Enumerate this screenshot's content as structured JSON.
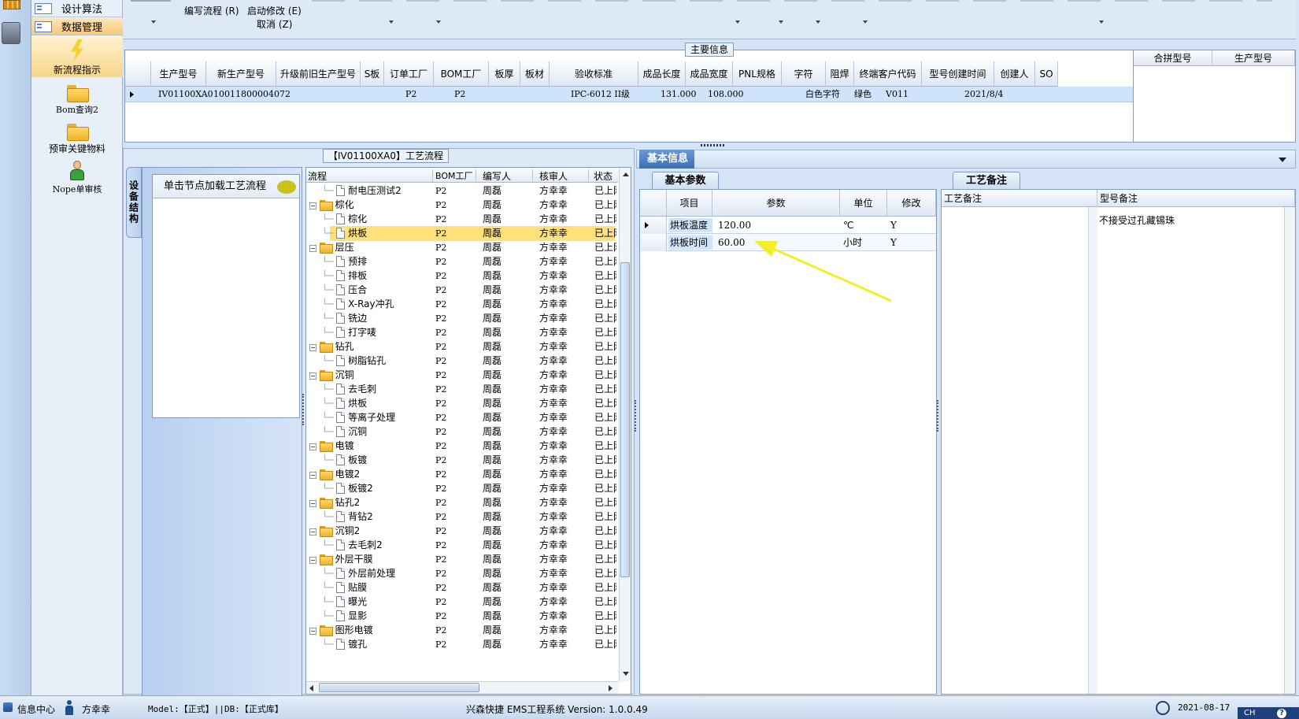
{
  "nav": {
    "top_items": [
      {
        "label": "设计算法"
      },
      {
        "label": "数据管理"
      }
    ],
    "items": [
      {
        "label": "新流程指示"
      },
      {
        "label": "Bom查询2"
      },
      {
        "label": "预审关键物料"
      },
      {
        "label": "Nope单审核"
      }
    ]
  },
  "toolbar": {
    "write_flow": "编写流程 (R)",
    "start_modify": "启动修改 (E)",
    "cancel": "取消 (Z)"
  },
  "main_info": {
    "title": "主要信息",
    "columns": [
      "生产型号",
      "新生产型号",
      "升级前旧生产型号",
      "S板",
      "订单工厂",
      "BOM工厂",
      "板厚",
      "板材",
      "验收标准",
      "成品长度",
      "成品宽度",
      "PNL规格",
      "字符",
      "阻焊",
      "终端客户代码",
      "型号创建时间",
      "创建人",
      "SO"
    ],
    "row": {
      "model": "IV01100XA0",
      "new_model": "10011800004072",
      "order_factory": "P2",
      "bom_factory": "P2",
      "standard": "IPC-6012 II级",
      "length": "131.000",
      "width": "108.000",
      "char": "白色字符",
      "mask": "绿色",
      "customer": "V011",
      "created": "2021/8/4"
    },
    "side_columns": [
      "合拼型号",
      "生产型号"
    ]
  },
  "flow": {
    "title": "【IV01100XA0】工艺流程",
    "side_tab": "设备结构",
    "hint": "单击节点加载工艺流程",
    "columns": [
      "流程",
      "BOM工厂",
      "编写人",
      "核审人",
      "状态"
    ],
    "rows": [
      {
        "name": "耐电压测试2",
        "level": 2,
        "factory": "P2",
        "writer": "周磊",
        "reviewer": "方幸幸",
        "status": "已上网"
      },
      {
        "name": "棕化",
        "level": 1,
        "factory": "P2",
        "writer": "周磊",
        "reviewer": "方幸幸",
        "status": "已上网"
      },
      {
        "name": "棕化",
        "level": 2,
        "factory": "P2",
        "writer": "周磊",
        "reviewer": "方幸幸",
        "status": "已上网"
      },
      {
        "name": "烘板",
        "level": 2,
        "factory": "P2",
        "writer": "周磊",
        "reviewer": "方幸幸",
        "status": "已上网",
        "selected": true
      },
      {
        "name": "层压",
        "level": 1,
        "factory": "P2",
        "writer": "周磊",
        "reviewer": "方幸幸",
        "status": "已上网"
      },
      {
        "name": "预排",
        "level": 2,
        "factory": "P2",
        "writer": "周磊",
        "reviewer": "方幸幸",
        "status": "已上网"
      },
      {
        "name": "排板",
        "level": 2,
        "factory": "P2",
        "writer": "周磊",
        "reviewer": "方幸幸",
        "status": "已上网"
      },
      {
        "name": "压合",
        "level": 2,
        "factory": "P2",
        "writer": "周磊",
        "reviewer": "方幸幸",
        "status": "已上网"
      },
      {
        "name": "X-Ray冲孔",
        "level": 2,
        "factory": "P2",
        "writer": "周磊",
        "reviewer": "方幸幸",
        "status": "已上网"
      },
      {
        "name": "铣边",
        "level": 2,
        "factory": "P2",
        "writer": "周磊",
        "reviewer": "方幸幸",
        "status": "已上网"
      },
      {
        "name": "打字唛",
        "level": 2,
        "factory": "P2",
        "writer": "周磊",
        "reviewer": "方幸幸",
        "status": "已上网"
      },
      {
        "name": "钻孔",
        "level": 1,
        "factory": "P2",
        "writer": "周磊",
        "reviewer": "方幸幸",
        "status": "已上网"
      },
      {
        "name": "树脂钻孔",
        "level": 2,
        "factory": "P2",
        "writer": "周磊",
        "reviewer": "方幸幸",
        "status": "已上网"
      },
      {
        "name": "沉铜",
        "level": 1,
        "factory": "P2",
        "writer": "周磊",
        "reviewer": "方幸幸",
        "status": "已上网"
      },
      {
        "name": "去毛刺",
        "level": 2,
        "factory": "P2",
        "writer": "周磊",
        "reviewer": "方幸幸",
        "status": "已上网"
      },
      {
        "name": "烘板",
        "level": 2,
        "factory": "P2",
        "writer": "周磊",
        "reviewer": "方幸幸",
        "status": "已上网"
      },
      {
        "name": "等离子处理",
        "level": 2,
        "factory": "P2",
        "writer": "周磊",
        "reviewer": "方幸幸",
        "status": "已上网"
      },
      {
        "name": "沉铜",
        "level": 2,
        "factory": "P2",
        "writer": "周磊",
        "reviewer": "方幸幸",
        "status": "已上网"
      },
      {
        "name": "电镀",
        "level": 1,
        "factory": "P2",
        "writer": "周磊",
        "reviewer": "方幸幸",
        "status": "已上网"
      },
      {
        "name": "板镀",
        "level": 2,
        "factory": "P2",
        "writer": "周磊",
        "reviewer": "方幸幸",
        "status": "已上网"
      },
      {
        "name": "电镀2",
        "level": 1,
        "factory": "P2",
        "writer": "周磊",
        "reviewer": "方幸幸",
        "status": "已上网"
      },
      {
        "name": "板镀2",
        "level": 2,
        "factory": "P2",
        "writer": "周磊",
        "reviewer": "方幸幸",
        "status": "已上网"
      },
      {
        "name": "钻孔2",
        "level": 1,
        "factory": "P2",
        "writer": "周磊",
        "reviewer": "方幸幸",
        "status": "已上网"
      },
      {
        "name": "背钻2",
        "level": 2,
        "factory": "P2",
        "writer": "周磊",
        "reviewer": "方幸幸",
        "status": "已上网"
      },
      {
        "name": "沉铜2",
        "level": 1,
        "factory": "P2",
        "writer": "周磊",
        "reviewer": "方幸幸",
        "status": "已上网"
      },
      {
        "name": "去毛刺2",
        "level": 2,
        "factory": "P2",
        "writer": "周磊",
        "reviewer": "方幸幸",
        "status": "已上网"
      },
      {
        "name": "外层干膜",
        "level": 1,
        "factory": "P2",
        "writer": "周磊",
        "reviewer": "方幸幸",
        "status": "已上网"
      },
      {
        "name": "外层前处理",
        "level": 2,
        "factory": "P2",
        "writer": "周磊",
        "reviewer": "方幸幸",
        "status": "已上网"
      },
      {
        "name": "贴膜",
        "level": 2,
        "factory": "P2",
        "writer": "周磊",
        "reviewer": "方幸幸",
        "status": "已上网"
      },
      {
        "name": "曝光",
        "level": 2,
        "factory": "P2",
        "writer": "周磊",
        "reviewer": "方幸幸",
        "status": "已上网"
      },
      {
        "name": "显影",
        "level": 2,
        "factory": "P2",
        "writer": "周磊",
        "reviewer": "方幸幸",
        "status": "已上网"
      },
      {
        "name": "图形电镀",
        "level": 1,
        "factory": "P2",
        "writer": "周磊",
        "reviewer": "方幸幸",
        "status": "已上网"
      },
      {
        "name": "镀孔",
        "level": 2,
        "factory": "P2",
        "writer": "周磊",
        "reviewer": "方幸幸",
        "status": "已上网"
      }
    ]
  },
  "basic": {
    "title": "基本信息",
    "tab": "基本参数",
    "columns": [
      "项目",
      "参数",
      "单位",
      "修改"
    ],
    "rows": [
      {
        "item": "烘板温度",
        "value": "120.00",
        "unit": "℃",
        "modify": "Y"
      },
      {
        "item": "烘板时间",
        "value": "60.00",
        "unit": "小时",
        "modify": "Y"
      }
    ]
  },
  "remark": {
    "tab": "工艺备注",
    "columns": [
      "工艺备注",
      "型号备注"
    ],
    "model_note": "不接受过孔藏锡珠"
  },
  "status": {
    "info_center": "信息中心",
    "user": "方幸幸",
    "model": "Model:【正式】||DB:【正式库】",
    "system": "兴森快捷 EMS工程系统 Version: 1.0.0.49",
    "date": "2021-08-17",
    "ime": "CH"
  },
  "colors": {
    "accent": "#3a6fb6",
    "selected_row": "#ffe07a",
    "grid_selected": "#cfe3fa"
  }
}
